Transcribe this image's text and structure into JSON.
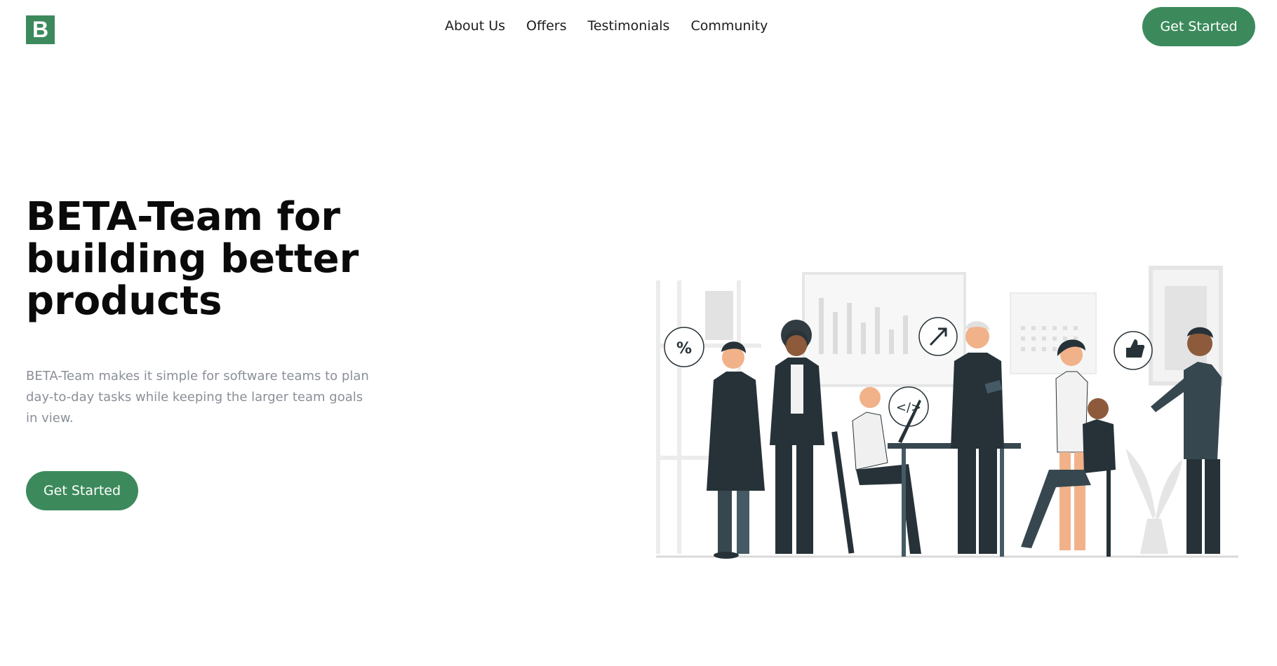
{
  "header": {
    "logo_letter": "B",
    "nav": [
      "About Us",
      "Offers",
      "Testimonials",
      "Community"
    ],
    "cta_label": "Get Started"
  },
  "hero": {
    "title": "BETA-Team for building better products",
    "description": "BETA-Team makes it simple for software teams to plan day-to-day tasks while keeping the larger team goals in view.",
    "cta_label": "Get Started"
  },
  "illustration": {
    "bubbles": [
      "%",
      "</>"
    ]
  },
  "colors": {
    "accent": "#3c8a5c",
    "text_muted": "#8a8f98",
    "figure_dark": "#263238",
    "figure_grey": "#e6e6e6"
  }
}
